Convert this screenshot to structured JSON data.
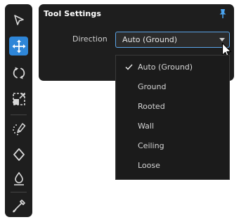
{
  "toolbar": {
    "tools": [
      {
        "name": "select",
        "icon": "cursor-arrow-icon",
        "active": false
      },
      {
        "name": "move",
        "icon": "move-arrows-icon",
        "active": true
      },
      {
        "name": "rotate",
        "icon": "rotate-icon",
        "active": false
      },
      {
        "name": "scale",
        "icon": "scale-icon",
        "active": false
      },
      {
        "name": "place",
        "icon": "place-pen-icon",
        "active": false
      },
      {
        "name": "fill",
        "icon": "diamond-icon",
        "active": false
      },
      {
        "name": "paint",
        "icon": "droplet-icon",
        "active": false
      },
      {
        "name": "eyedropper",
        "icon": "eyedropper-icon",
        "active": false
      }
    ],
    "accent_color": "#2e86d8"
  },
  "panel": {
    "title": "Tool Settings",
    "pin_icon": "pin-icon",
    "direction_label": "Direction",
    "direction_value": "Auto (Ground)"
  },
  "dropdown": {
    "options": [
      {
        "label": "Auto (Ground)",
        "selected": true
      },
      {
        "label": "Ground",
        "selected": false
      },
      {
        "label": "Rooted",
        "selected": false
      },
      {
        "label": "Wall",
        "selected": false
      },
      {
        "label": "Ceiling",
        "selected": false
      },
      {
        "label": "Loose",
        "selected": false
      }
    ]
  }
}
